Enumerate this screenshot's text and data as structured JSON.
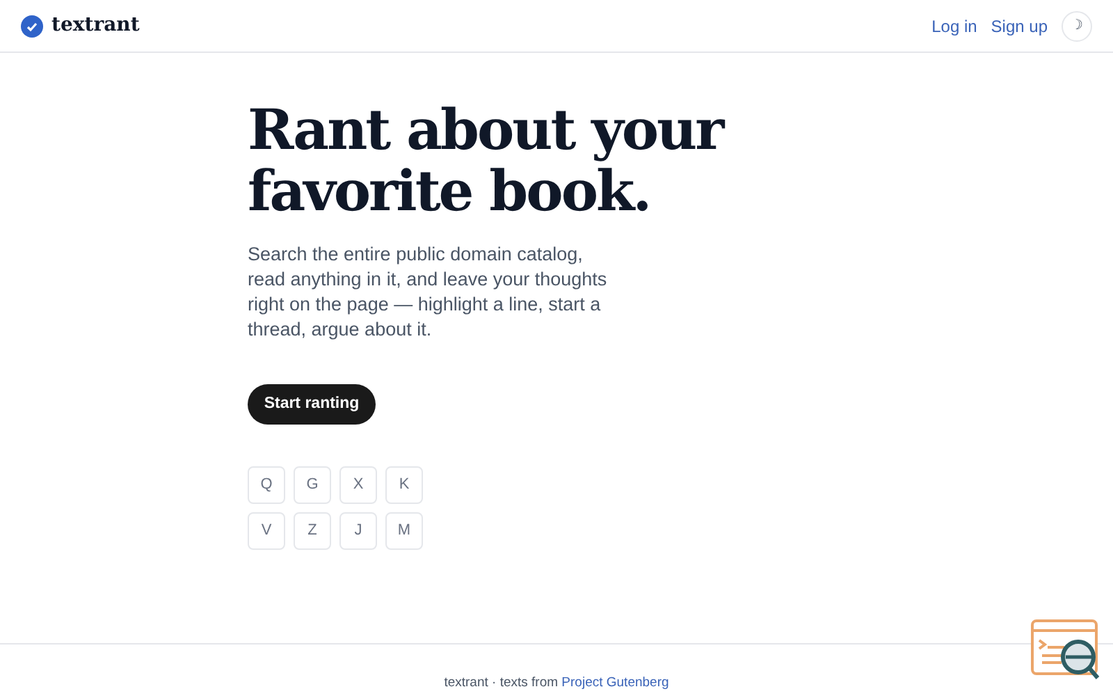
{
  "header": {
    "logo": "textrant",
    "links": [
      "Log in",
      "Sign up"
    ],
    "theme_toggle": "☽"
  },
  "hero": {
    "title": "Rant about your favorite book.",
    "body": "Search the entire public domain catalog, read anything in it, and leave your thoughts right on the page — highlight a line, start a thread, argue about it.",
    "button": "Start ranting"
  },
  "letters": [
    "Q",
    "G",
    "X",
    "K",
    "V",
    "Z",
    "J",
    "M"
  ],
  "footer": {
    "text": "textrant · texts from",
    "link": "Project Gutenberg"
  }
}
